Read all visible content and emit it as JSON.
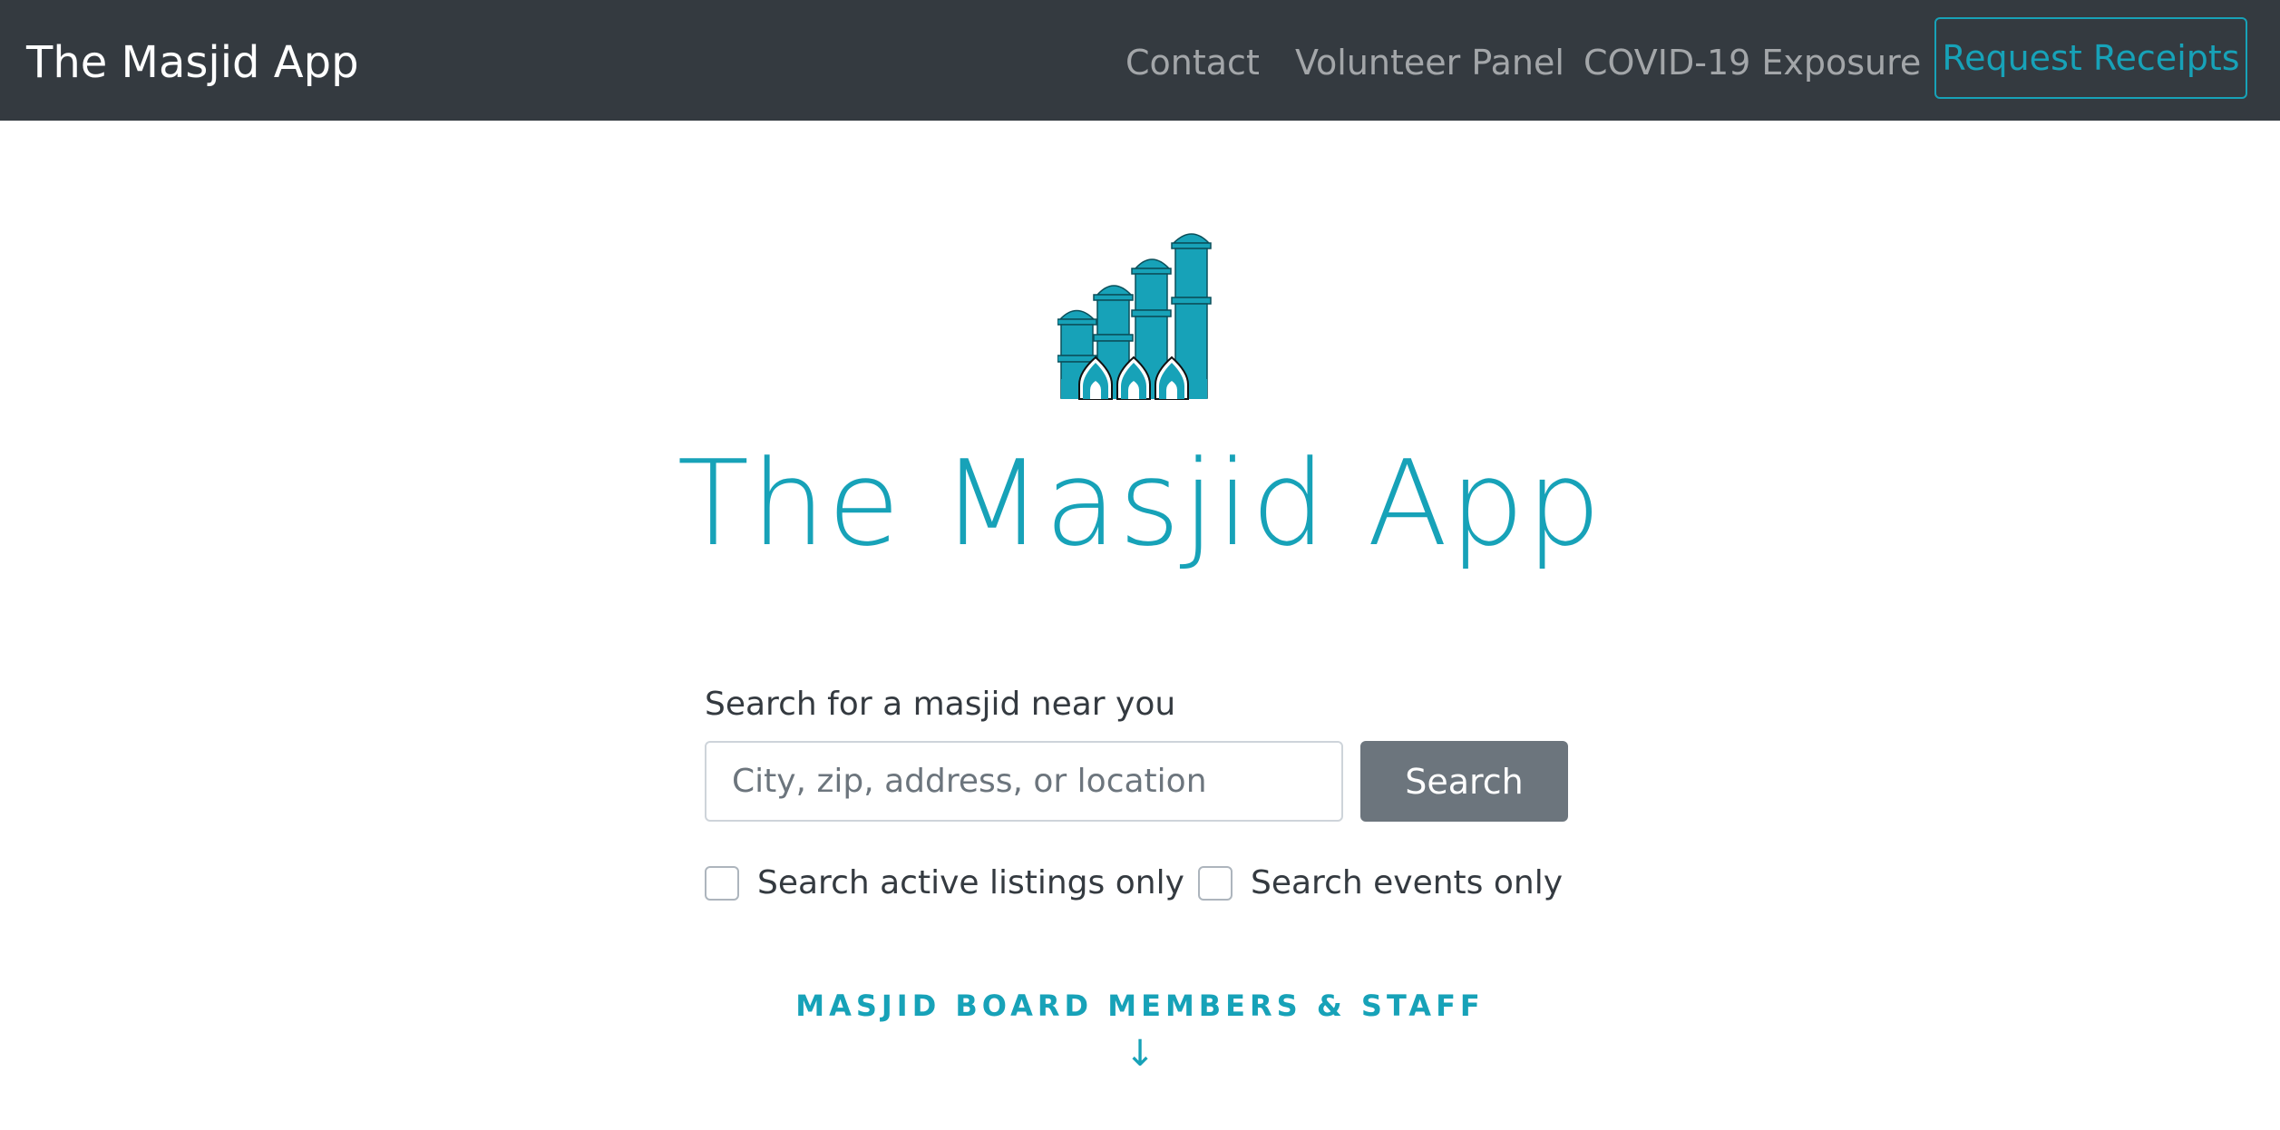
{
  "navbar": {
    "brand": "The Masjid App",
    "links": [
      {
        "label": "Contact"
      },
      {
        "label": "Volunteer Panel"
      },
      {
        "label": "COVID-19 Exposure"
      }
    ],
    "cta_label": "Request Receipts"
  },
  "hero": {
    "logo_icon": "mosque-minarets-icon",
    "title": "The Masjid App"
  },
  "search": {
    "label": "Search for a masjid near you",
    "value": "",
    "placeholder": "City, zip, address, or location",
    "button_label": "Search",
    "filters": [
      {
        "label": "Search active listings only",
        "checked": false
      },
      {
        "label": "Search events only",
        "checked": false
      }
    ]
  },
  "board": {
    "label": "MASJID BOARD MEMBERS & STAFF",
    "arrow": "↓"
  },
  "colors": {
    "navbar_bg": "#343a40",
    "accent": "#17a2b8",
    "search_button": "#6c757d"
  }
}
